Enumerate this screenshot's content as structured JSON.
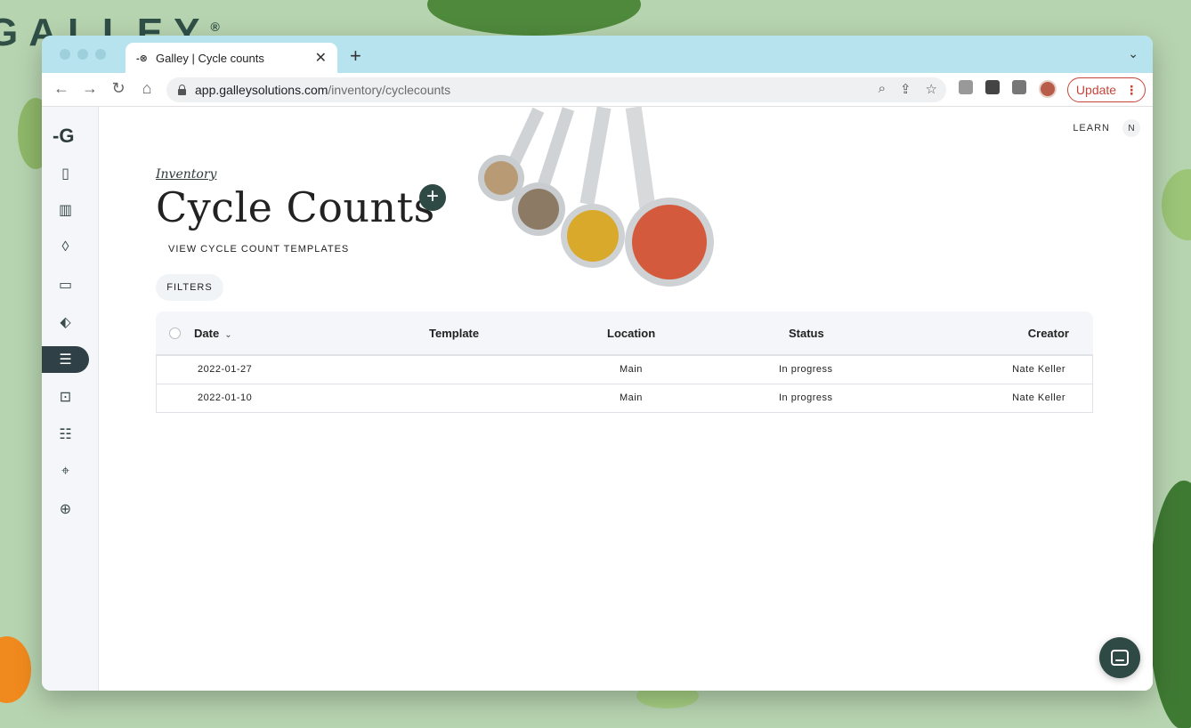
{
  "background": {
    "brand": "GALLEY",
    "registered": "®"
  },
  "browser": {
    "tab_title": "Galley | Cycle counts",
    "favicon": "-⊗",
    "new_tab": "+",
    "url_host": "app.galleysolutions.com",
    "url_path": "/inventory/cyclecounts",
    "update_label": "Update"
  },
  "header": {
    "learn": "LEARN",
    "user_initial": "N"
  },
  "page": {
    "breadcrumb": "Inventory",
    "title": "Cycle Counts",
    "add_label": "+",
    "templates_link": "VIEW CYCLE COUNT TEMPLATES",
    "filters": "FILTERS"
  },
  "sidebar": {
    "logo": "-G",
    "items": [
      {
        "name": "clipboard-icon",
        "glyph": "▯"
      },
      {
        "name": "book-icon",
        "glyph": "📖"
      },
      {
        "name": "onion-icon",
        "glyph": "◊"
      },
      {
        "name": "containers-icon",
        "glyph": "▭"
      },
      {
        "name": "tag-icon",
        "glyph": "⬖"
      },
      {
        "name": "inventory-icon",
        "glyph": "☰"
      },
      {
        "name": "cart-icon",
        "glyph": "⊡"
      },
      {
        "name": "document-icon",
        "glyph": "☷"
      },
      {
        "name": "location-icon",
        "glyph": "⌖"
      },
      {
        "name": "dining-icon",
        "glyph": "⊕"
      }
    ]
  },
  "table": {
    "columns": [
      "Date",
      "Template",
      "Location",
      "Status",
      "Creator"
    ],
    "rows": [
      {
        "date": "2022-01-27",
        "template": "",
        "location": "Main",
        "status": "In progress",
        "creator": "Nate Keller"
      },
      {
        "date": "2022-01-10",
        "template": "",
        "location": "Main",
        "status": "In progress",
        "creator": "Nate Keller"
      }
    ]
  },
  "colors": {
    "accent": "#2f4a44",
    "update": "#c5453b",
    "tabbar": "#b6e3ee",
    "backdrop": "#b7d4b0"
  }
}
